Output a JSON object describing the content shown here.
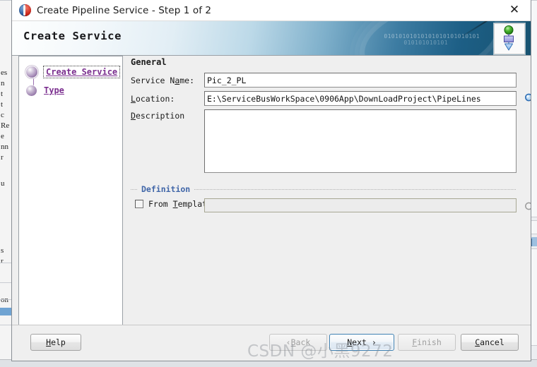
{
  "window": {
    "title": "Create Pipeline Service - Step 1 of 2",
    "app_icon": "pipeline-ball-icon",
    "close_label": "✕"
  },
  "banner": {
    "heading": "Create Service",
    "binary_line1": "01010101010101010101010101",
    "binary_line2": "010101010101",
    "icon": "pipeline-flow-icon"
  },
  "steps": {
    "items": [
      {
        "label": "Create Service",
        "selected": true
      },
      {
        "label": "Type",
        "selected": false
      }
    ]
  },
  "form": {
    "group_general": "General",
    "service_name": {
      "label_pre": "Service N",
      "label_mnemonic": "a",
      "label_post": "me:",
      "value": "Pic_2_PL",
      "placeholder": ""
    },
    "location": {
      "label_mnemonic": "L",
      "label_post": "ocation:",
      "value": "E:\\ServiceBusWorkSpace\\0906App\\DownLoadProject\\PipeLines",
      "placeholder": "",
      "browse_icon": "magnifier-icon"
    },
    "description": {
      "label_mnemonic": "D",
      "label_post": "escription",
      "value": "",
      "placeholder": ""
    },
    "group_definition": "Definition",
    "from_template": {
      "label_pre": "From ",
      "label_mnemonic": "T",
      "label_post": "emplate",
      "checked": false,
      "value": "",
      "placeholder": "",
      "browse_icon": "magnifier-icon-disabled",
      "disabled": true
    }
  },
  "footer": {
    "help": {
      "pre": "",
      "mnemonic": "H",
      "post": "elp",
      "disabled": false,
      "default": false
    },
    "back": {
      "pre": "‹ ",
      "mnemonic": "B",
      "post": "ack",
      "disabled": true,
      "default": false
    },
    "next": {
      "pre": "",
      "mnemonic": "N",
      "post": "ext ›",
      "disabled": false,
      "default": true
    },
    "finish": {
      "pre": "",
      "mnemonic": "F",
      "post": "inish",
      "disabled": true,
      "default": false
    },
    "cancel": {
      "pre": "",
      "mnemonic": "C",
      "post": "ancel",
      "disabled": false,
      "default": false
    }
  },
  "watermark": {
    "text": "CSDN @小黑9272"
  },
  "background": {
    "left_text_fragments": [
      "es",
      "n",
      "t",
      "t",
      "c",
      "Re",
      "e",
      "nn",
      "r",
      "u",
      "s",
      "r",
      "on"
    ],
    "right_note": "background-window-edge"
  },
  "colors": {
    "banner_dark": "#17526f",
    "step_link": "#7b2f8f",
    "group_header": "#4066a8",
    "default_button_border": "#3c7fb1"
  }
}
